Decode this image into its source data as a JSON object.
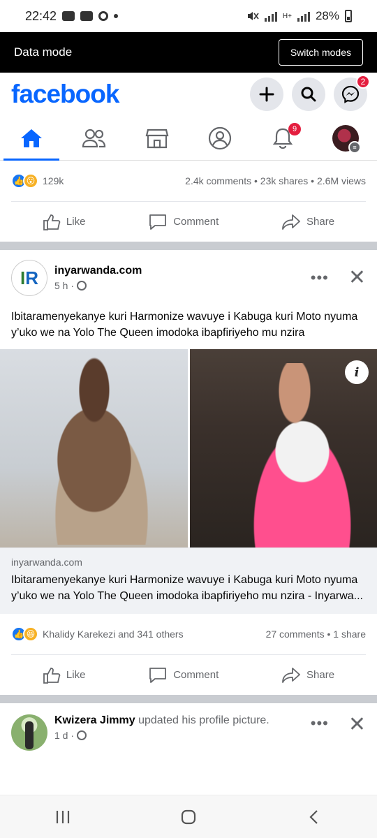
{
  "status_bar": {
    "time": "22:42",
    "network": "H+",
    "battery": "28%"
  },
  "data_mode": {
    "label": "Data mode",
    "button": "Switch modes"
  },
  "header": {
    "logo": "facebook",
    "messenger_badge": "2"
  },
  "nav": {
    "notifications_badge": "9"
  },
  "post1_summary": {
    "reaction_count": "129k",
    "comments": "2.4k comments",
    "shares": "23k shares",
    "views": "2.6M views"
  },
  "actions": {
    "like": "Like",
    "comment": "Comment",
    "share": "Share"
  },
  "post2": {
    "author": "inyarwanda.com",
    "time": "5 h ·",
    "text": "Ibitaramenyekanye kuri Harmonize wavuye i Kabuga kuri Moto nyuma y’uko we na Yolo The Queen imodoka ibapfiriyeho mu nzira",
    "link_domain": "inyarwanda.com",
    "link_title": "Ibitaramenyekanye kuri Harmonize wavuye i Kabuga kuri Moto nyuma y’uko we na Yolo The Queen imodoka ibapfiriyeho mu nzira - Inyarwa...",
    "reactors": "Khalidy Karekezi and 341 others",
    "comments": "27 comments",
    "shares": "1 share",
    "more": "•••"
  },
  "post3": {
    "name": "Kwizera Jimmy",
    "action": "updated his profile picture.",
    "time": "1 d ·",
    "more": "•••"
  }
}
